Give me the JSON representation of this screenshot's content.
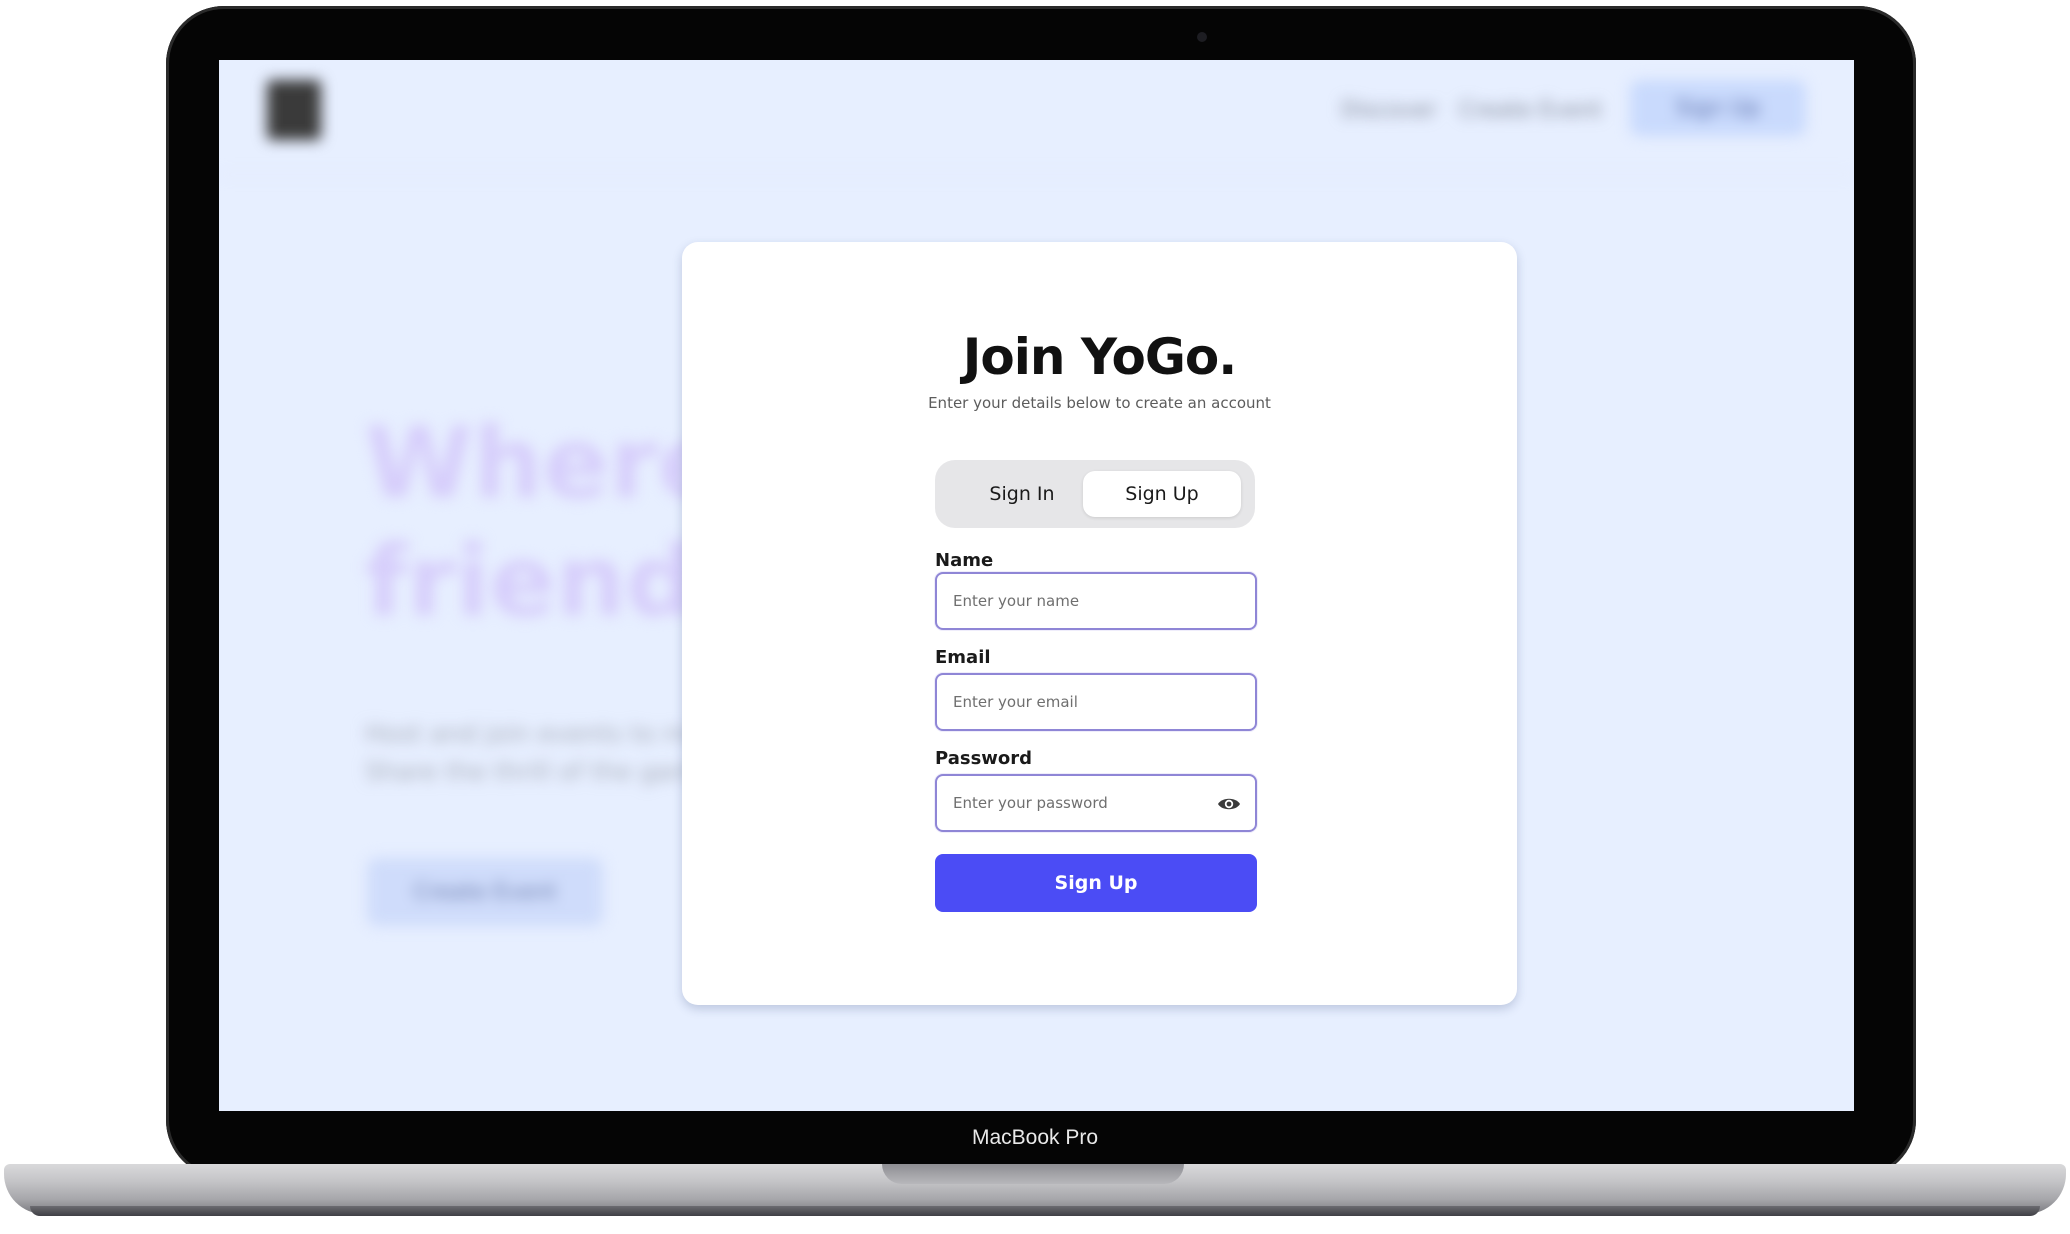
{
  "device": {
    "label": "MacBook Pro"
  },
  "background": {
    "nav": {
      "links": [
        "Discover",
        "Create Event"
      ],
      "cta": "Sign Up"
    },
    "hero_lines": [
      "Where f",
      "friendsl"
    ],
    "description": "Host and join events to meet new people. Share the thrill of the game with friends.",
    "cta": "Create Event"
  },
  "auth": {
    "title": "Join YoGo.",
    "subtitle": "Enter your details below to create an account",
    "tabs": {
      "sign_in": "Sign In",
      "sign_up": "Sign Up",
      "active": "sign_up"
    },
    "fields": {
      "name": {
        "label": "Name",
        "placeholder": "Enter your name",
        "value": ""
      },
      "email": {
        "label": "Email",
        "placeholder": "Enter your email",
        "value": ""
      },
      "password": {
        "label": "Password",
        "placeholder": "Enter your password",
        "value": ""
      }
    },
    "submit_label": "Sign Up"
  },
  "colors": {
    "accent": "#4b4cf5",
    "screen_bg": "#e7efff",
    "input_border": "#8f86d6"
  }
}
